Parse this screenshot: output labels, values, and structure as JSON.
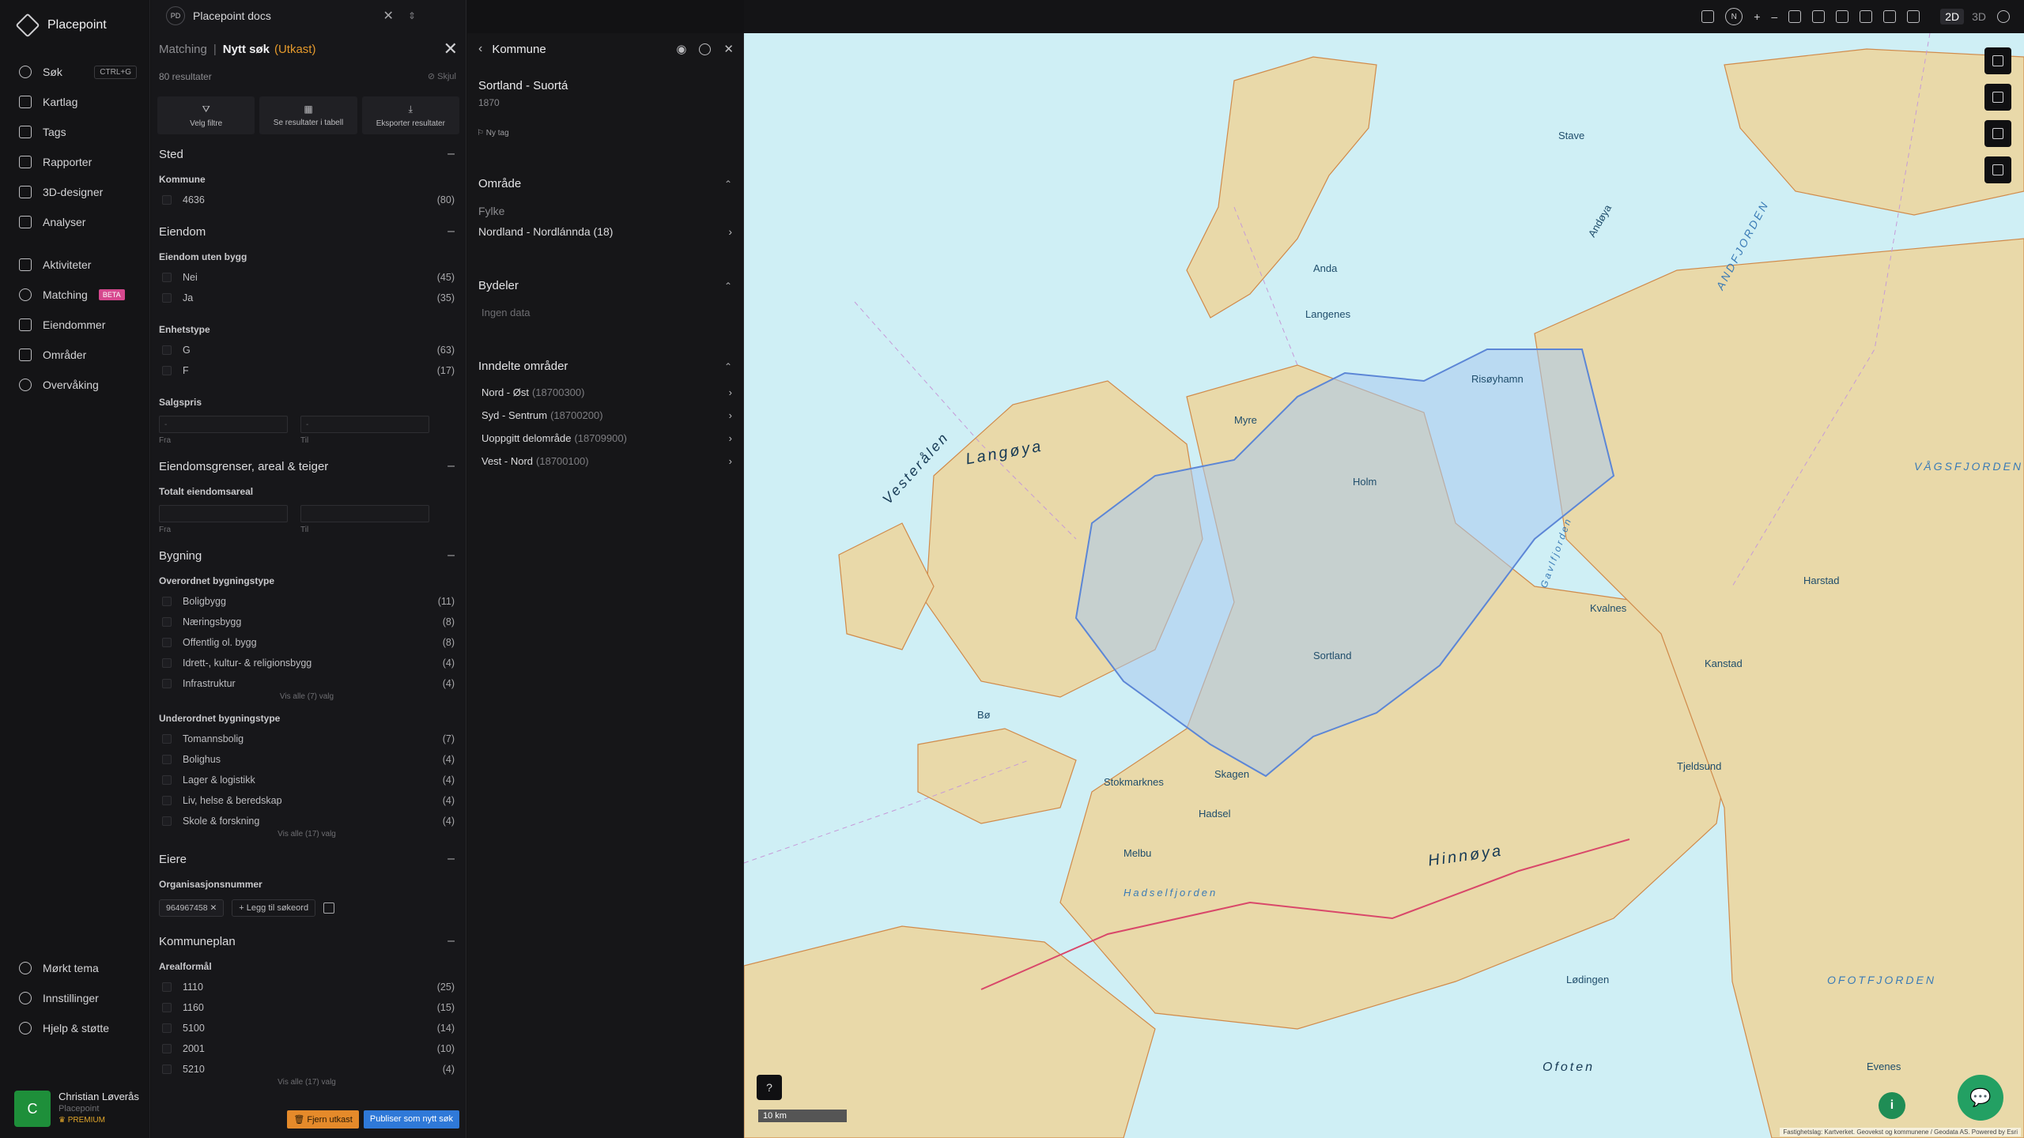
{
  "nav": {
    "brand": "Placepoint",
    "items": [
      {
        "label": "Søk",
        "shortcut": "CTRL+G"
      },
      {
        "label": "Kartlag"
      },
      {
        "label": "Tags"
      },
      {
        "label": "Rapporter"
      },
      {
        "label": "3D-designer"
      },
      {
        "label": "Analyser"
      },
      {
        "label": "Aktiviteter"
      },
      {
        "label": "Matching",
        "badge": "BETA"
      },
      {
        "label": "Eiendommer"
      },
      {
        "label": "Områder"
      },
      {
        "label": "Overvåking"
      }
    ],
    "bottom": [
      {
        "label": "Mørkt tema"
      },
      {
        "label": "Innstillinger"
      },
      {
        "label": "Hjelp & støtte"
      }
    ],
    "user": {
      "initial": "C",
      "name": "Christian Løverås",
      "org": "Placepoint",
      "tier": "PREMIUM"
    }
  },
  "doc_tab": {
    "badge": "PD",
    "title": "Placepoint docs"
  },
  "filter_panel": {
    "crumb": "Matching",
    "title": "Nytt søk",
    "status": "(Utkast)",
    "result_count": "80 resultater",
    "hide_label": "Skjul",
    "actions": [
      "Velg filtre",
      "Se resultater i tabell",
      "Eksporter resultater"
    ],
    "sted": {
      "title": "Sted",
      "kommune_label": "Kommune",
      "options": [
        {
          "label": "4636",
          "count": "(80)"
        }
      ]
    },
    "eiendom": {
      "title": "Eiendom",
      "uten_bygg_label": "Eiendom uten bygg",
      "uten_bygg": [
        {
          "label": "Nei",
          "count": "(45)"
        },
        {
          "label": "Ja",
          "count": "(35)"
        }
      ],
      "enhetstype_label": "Enhetstype",
      "enhetstype": [
        {
          "label": "G",
          "count": "(63)"
        },
        {
          "label": "F",
          "count": "(17)"
        }
      ],
      "salgspris_label": "Salgspris",
      "from_placeholder": "-",
      "to_placeholder": "-",
      "from_label": "Fra",
      "to_label": "Til"
    },
    "grenser": {
      "title": "Eiendomsgrenser, areal & teiger",
      "areal_label": "Totalt eiendomsareal",
      "from_label": "Fra",
      "to_label": "Til"
    },
    "bygning": {
      "title": "Bygning",
      "overordnet_label": "Overordnet bygningstype",
      "overordnet": [
        {
          "label": "Boligbygg",
          "count": "(11)"
        },
        {
          "label": "Næringsbygg",
          "count": "(8)"
        },
        {
          "label": "Offentlig ol. bygg",
          "count": "(8)"
        },
        {
          "label": "Idrett-, kultur- & religionsbygg",
          "count": "(4)"
        },
        {
          "label": "Infrastruktur",
          "count": "(4)"
        }
      ],
      "overordnet_more": "Vis alle (7) valg",
      "underordnet_label": "Underordnet bygningstype",
      "underordnet": [
        {
          "label": "Tomannsbolig",
          "count": "(7)"
        },
        {
          "label": "Bolighus",
          "count": "(4)"
        },
        {
          "label": "Lager & logistikk",
          "count": "(4)"
        },
        {
          "label": "Liv, helse & beredskap",
          "count": "(4)"
        },
        {
          "label": "Skole & forskning",
          "count": "(4)"
        }
      ],
      "underordnet_more": "Vis alle (17) valg"
    },
    "eiere": {
      "title": "Eiere",
      "org_label": "Organisasjonsnummer",
      "chip": "964967458",
      "add_keyword": "Legg til søkeord"
    },
    "kommuneplan": {
      "title": "Kommuneplan",
      "arealformal_label": "Arealformål",
      "options": [
        {
          "label": "1110",
          "count": "(25)"
        },
        {
          "label": "1160",
          "count": "(15)"
        },
        {
          "label": "5100",
          "count": "(14)"
        },
        {
          "label": "2001",
          "count": "(10)"
        },
        {
          "label": "5210",
          "count": "(4)"
        }
      ],
      "more": "Vis alle (17) valg"
    },
    "footer": {
      "delete": "Fjern utkast",
      "publish": "Publiser som nytt søk"
    }
  },
  "kommune_panel": {
    "title": "Kommune",
    "name": "Sortland - Suortá",
    "id": "1870",
    "new_tag": "Ny tag",
    "omrade": {
      "title": "Område",
      "fylke_label": "Fylke",
      "fylke": "Nordland - Nordlánnda (18)"
    },
    "bydeler": {
      "title": "Bydeler",
      "empty": "Ingen data"
    },
    "inndelte": {
      "title": "Inndelte områder",
      "items": [
        {
          "name": "Nord - Øst",
          "code": "(18700300)"
        },
        {
          "name": "Syd - Sentrum",
          "code": "(18700200)"
        },
        {
          "name": "Uoppgitt delområde",
          "code": "(18709900)"
        },
        {
          "name": "Vest - Nord",
          "code": "(18700100)"
        }
      ]
    }
  },
  "toolbar": {
    "north": "N",
    "mode_2d": "2D",
    "mode_3d": "3D"
  },
  "map": {
    "scale": "10 km",
    "help": "?",
    "attribution": "Fastighetslag: Kartverket. Geovekst og kommunene / Geodata AS. Powered by Esri",
    "labels": {
      "vesteralen": "Vesterålen",
      "langoya": "Langøya",
      "hinnoya": "Hinnøya",
      "andfjorden": "ANDFJORDEN",
      "vagsfjorden": "VÅGSFJORDEN",
      "ofoten": "Ofoten",
      "ofotfjorden": "OFOTFJORDEN",
      "andoya": "Andøya",
      "anda": "Anda",
      "sortland": "Sortland",
      "myre": "Myre",
      "hadsel": "Hadsel",
      "melbu": "Melbu",
      "harstad": "Harstad",
      "skagen": "Skagen",
      "stokmarknes": "Stokmarknes",
      "risoyhamn": "Risøyhamn",
      "lodingen": "Lødingen",
      "evenes": "Evenes",
      "hadselfjorden": "Hadselfjorden",
      "gavlfjorden": "Gavlfjorden",
      "lovenes": "Langenes",
      "kvalnes": "Kvalnes",
      "tjeldsund": "Tjeldsund",
      "kanstad": "Kanstad",
      "stave": "Stave",
      "bo": "Bø",
      "holm": "Holm"
    }
  }
}
